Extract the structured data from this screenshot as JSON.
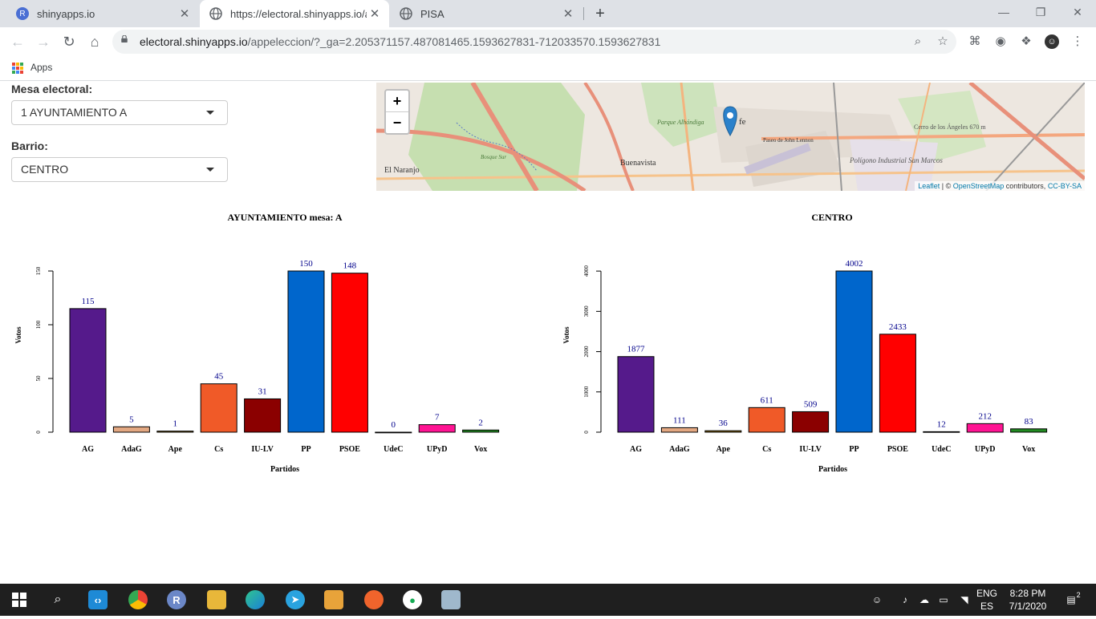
{
  "browser": {
    "tabs": [
      {
        "title": "shinyapps.io",
        "close": "✕",
        "fav_color": "#4a6fd4",
        "fav_letter": "R"
      },
      {
        "title": "https://electoral.shinyapps.io/app",
        "close": "✕",
        "fav_color": "#5f6368",
        "fav_letter": ""
      },
      {
        "title": "PISA",
        "close": "✕",
        "fav_color": "#5f6368",
        "fav_letter": ""
      }
    ],
    "new_tab": "+",
    "url_host": "electoral.shinyapps.io",
    "url_path": "/appeleccion/?_ga=2.205371157.487081465.1593627831-712033570.1593627831",
    "bookmarks_label": "Apps"
  },
  "filters": {
    "mesa_label": "Mesa electoral:",
    "mesa_value": "1 AYUNTAMIENTO A",
    "barrio_label": "Barrio:",
    "barrio_value": "CENTRO"
  },
  "map": {
    "zoom_in": "+",
    "zoom_out": "−",
    "labels": [
      "El Naranjo",
      "Buenavista",
      "Parque Alhóndiga",
      "Paseo de John Lennon",
      "Polígono Industrial San Marcos",
      "Cerro de los Ángeles 670 m",
      "Bosque Sur",
      "fe"
    ],
    "attribution_leaflet": "Leaflet",
    "attribution_sep": " | © ",
    "attribution_osm": "OpenStreetMap",
    "attribution_contrib": " contributors, ",
    "attribution_license": "CC-BY-SA"
  },
  "chart_data": [
    {
      "type": "bar",
      "title": "AYUNTAMIENTO mesa:  A",
      "xlabel": "Partidos",
      "ylabel": "Votos",
      "categories": [
        "AG",
        "AdaG",
        "Ape",
        "Cs",
        "IU-LV",
        "PP",
        "PSOE",
        "UdeC",
        "UPyD",
        "Vox"
      ],
      "values": [
        115,
        5,
        1,
        45,
        31,
        150,
        148,
        0,
        7,
        2
      ],
      "colors": [
        "#551a8b",
        "#e3a882",
        "#8b6914",
        "#f05a28",
        "#8b0000",
        "#0066cc",
        "#ff0000",
        "#ffffff",
        "#ff1493",
        "#228b22"
      ],
      "yticks": [
        0,
        50,
        100,
        150
      ],
      "ylim": [
        0,
        150
      ],
      "label_color": "#00008b"
    },
    {
      "type": "bar",
      "title": "CENTRO",
      "xlabel": "Partidos",
      "ylabel": "Votos",
      "categories": [
        "AG",
        "AdaG",
        "Ape",
        "Cs",
        "IU-LV",
        "PP",
        "PSOE",
        "UdeC",
        "UPyD",
        "Vox"
      ],
      "values": [
        1877,
        111,
        36,
        611,
        509,
        4002,
        2433,
        12,
        212,
        83
      ],
      "colors": [
        "#551a8b",
        "#e3a882",
        "#8b6914",
        "#f05a28",
        "#8b0000",
        "#0066cc",
        "#ff0000",
        "#ffffff",
        "#ff1493",
        "#228b22"
      ],
      "yticks": [
        0,
        1000,
        2000,
        3000,
        4000
      ],
      "ylim": [
        0,
        4002
      ],
      "label_color": "#00008b"
    }
  ],
  "taskbar": {
    "lang_top": "ENG",
    "lang_bottom": "ES",
    "time": "8:28 PM",
    "date": "7/1/2020",
    "notif_count": "2"
  }
}
